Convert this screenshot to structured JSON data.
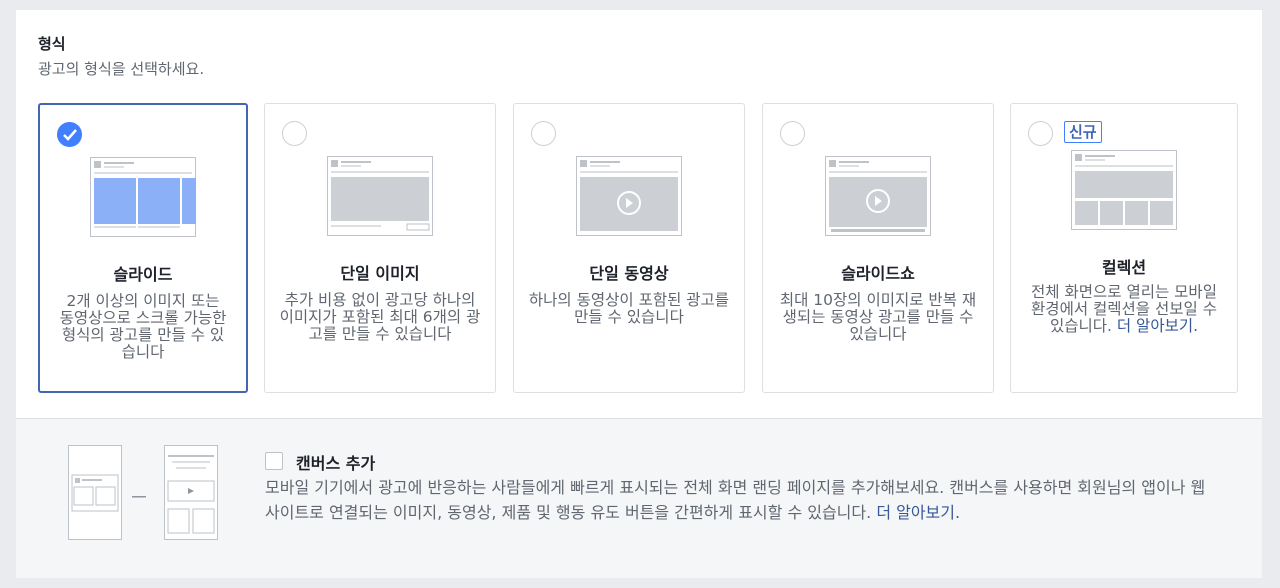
{
  "format": {
    "title": "형식",
    "subtitle": "광고의 형식을 선택하세요."
  },
  "cards": [
    {
      "name": "슬라이드",
      "desc": "2개 이상의 이미지 또는 동영상으로 스크롤 가능한 형식의 광고를 만들 수 있습니다",
      "selected": true
    },
    {
      "name": "단일 이미지",
      "desc": "추가 비용 없이 광고당 하나의 이미지가 포함된 최대 6개의 광고를 만들 수 있습니다",
      "selected": false
    },
    {
      "name": "단일 동영상",
      "desc": "하나의 동영상이 포함된 광고를 만들 수 있습니다",
      "selected": false
    },
    {
      "name": "슬라이드쇼",
      "desc": "최대 10장의 이미지로 반복 재생되는 동영상 광고를 만들 수 있습니다",
      "selected": false
    },
    {
      "name": "컬렉션",
      "desc": "전체 화면으로 열리는 모바일 환경에서 컬렉션을 선보일 수 있습니다.",
      "link": "더 알아보기.",
      "badge": "신규",
      "selected": false
    }
  ],
  "canvas": {
    "title": "캔버스 추가",
    "desc": "모바일 기기에서 광고에 반응하는 사람들에게 빠르게 표시되는 전체 화면 랜딩 페이지를 추가해보세요. 캔버스를 사용하면 회원님의 앱이나 웹사이트로 연결되는 이미지, 동영상, 제품 및 행동 유도 버튼을 간편하게 표시할 수 있습니다.",
    "link": "더 알아보기.",
    "checked": false
  },
  "colors": {
    "accent": "#4080ff",
    "link": "#365899",
    "muted": "#606770"
  }
}
